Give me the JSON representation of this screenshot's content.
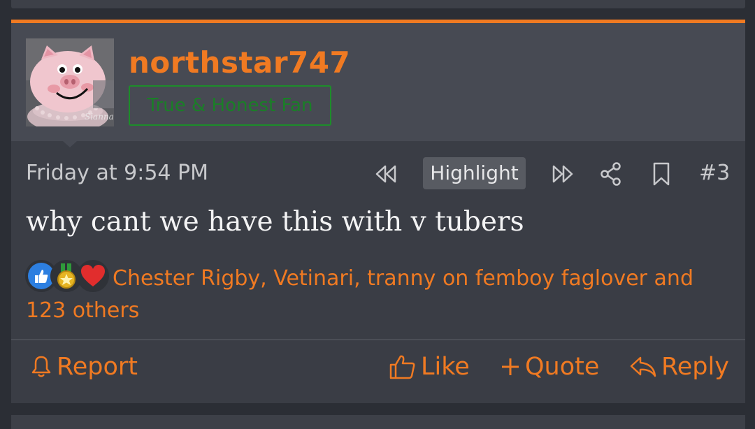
{
  "post": {
    "username": "northstar747",
    "user_title": "True & Honest Fan",
    "avatar_text": "Sianna SUGAR",
    "date": "Friday at 9:54 PM",
    "highlight_label": "Highlight",
    "post_number": "#3",
    "body": "why cant we have this with v tubers",
    "reactions": {
      "icons": [
        "like-icon",
        "winner-medal-icon",
        "heart-icon"
      ],
      "users": [
        "Chester Rigby",
        "Vetinari",
        "tranny on femboy faglover"
      ],
      "separator": ", ",
      "and_text": " and ",
      "others": "123 others"
    },
    "actions": {
      "report": "Report",
      "like": "Like",
      "quote": "Quote",
      "reply": "Reply"
    }
  },
  "colors": {
    "accent": "#f07a22",
    "title_green": "#1d8d2a",
    "card_bg": "#3a3d45",
    "header_bg": "#474a53"
  }
}
